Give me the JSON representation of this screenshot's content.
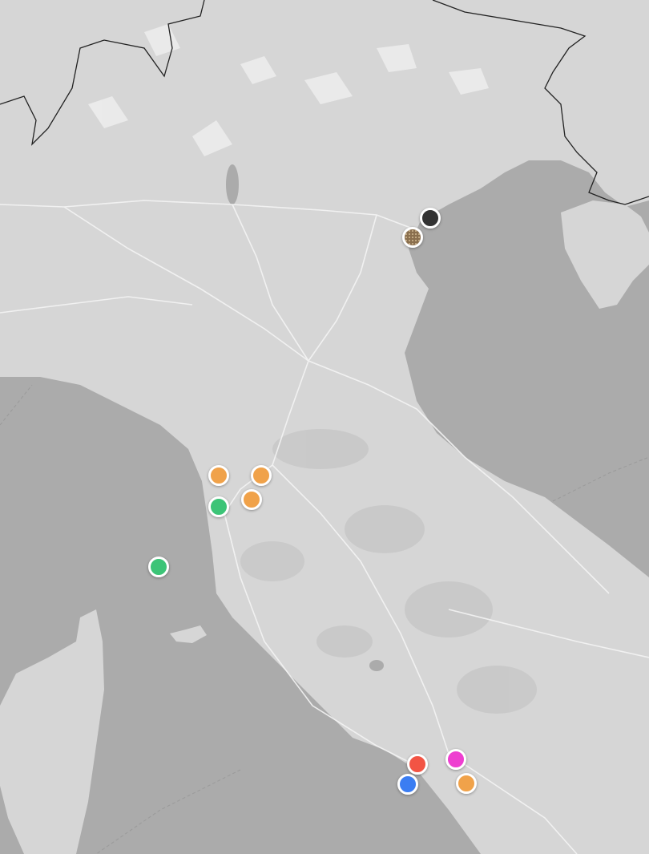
{
  "map": {
    "style": "grayscale-terrain",
    "water_color": "#ababab",
    "land_color": "#d6d6d6",
    "road_color": "#f4f4f4",
    "border_color": "#222222"
  },
  "markers": [
    {
      "id": "marker-venice-dark",
      "color": "#333333",
      "pattern": "solid"
    },
    {
      "id": "marker-venice-textured",
      "color": "#8a6f4e",
      "pattern": "dotted"
    },
    {
      "id": "marker-tuscany-orange-1",
      "color": "#f0a24a",
      "pattern": "solid"
    },
    {
      "id": "marker-tuscany-orange-2",
      "color": "#f0a24a",
      "pattern": "solid"
    },
    {
      "id": "marker-tuscany-orange-3",
      "color": "#f0a24a",
      "pattern": "solid"
    },
    {
      "id": "marker-tuscany-green",
      "color": "#3cc477",
      "pattern": "solid"
    },
    {
      "id": "marker-sea-green",
      "color": "#3cc477",
      "pattern": "solid"
    },
    {
      "id": "marker-rome-red",
      "color": "#f25444",
      "pattern": "solid"
    },
    {
      "id": "marker-rome-magenta",
      "color": "#ee3fd0",
      "pattern": "solid"
    },
    {
      "id": "marker-rome-blue",
      "color": "#3b7df2",
      "pattern": "solid"
    },
    {
      "id": "marker-rome-orange",
      "color": "#f0a24a",
      "pattern": "solid"
    }
  ]
}
